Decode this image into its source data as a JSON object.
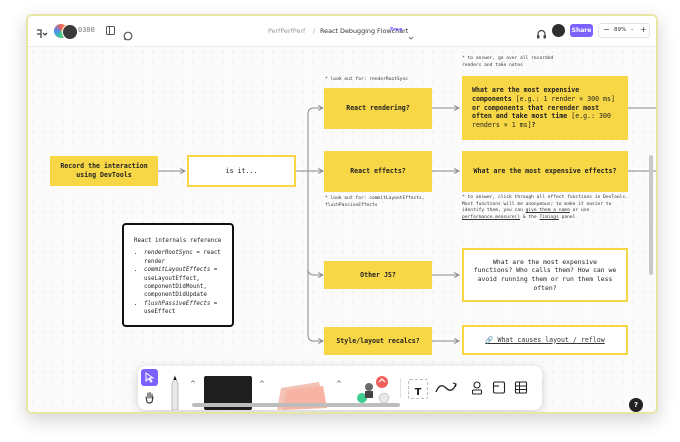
{
  "toolbar": {
    "counter": "0300",
    "breadcrumb_project": "PerfPerfPerf",
    "breadcrumb_sep": "/",
    "file_title": "React Debugging Flowchart",
    "badge": "Free",
    "share_label": "Share",
    "zoom": "89%",
    "zoom_minus": "−",
    "zoom_plus": "+"
  },
  "flow": {
    "start": "Record the interaction\nusing DevTools",
    "isit": "is it...",
    "branch_render": "React rendering?",
    "branch_effects": "React effects?",
    "branch_otherjs": "Other JS?",
    "branch_style": "Style/layout recalcs?",
    "result_render_a": "What are the most expensive components",
    "result_render_b": "[e.g.: 1 render × 300 ms]",
    "result_render_c": " or components that rerender most often and take most time ",
    "result_render_d": "[e.g.: 300 renders × 1 ms]",
    "result_render_e": "?",
    "result_effects": "What are the most expensive effects?",
    "result_otherjs": "What are the most expensive functions? Who calls them? How can we avoid running them or run them less often?",
    "result_style": "🔗 What causes layout / reflow"
  },
  "notes": {
    "top_right": "* to answer, go over all recorded\nrenders and take notes",
    "render_lookout": "* look out for: renderRootSync",
    "effects_lookout": "* look out for: commitLayoutEffects,\nflushPassiveEffects",
    "effects_answer_1": "* to answer, click through all effect functions in DevTools.",
    "effects_answer_2": "Most functions will be anonymous; to make it easier to",
    "effects_answer_3a": "identify them, you can ",
    "effects_answer_3b": "give them a name",
    "effects_answer_3c": " or use",
    "effects_answer_4a": "performance.measure()",
    "effects_answer_4b": " & the ",
    "effects_answer_4c": "Timings",
    "effects_answer_4d": " panel"
  },
  "reference": {
    "title": "React internals reference",
    "items": [
      {
        "fn": "renderRootSync",
        "rest": " = react render"
      },
      {
        "fn": "commitLayoutEffects",
        "rest": " = useLayoutEffect, componentDidMount, componentDidUpdate"
      },
      {
        "fn": "flushPassiveEffects",
        "rest": " = useEffect"
      }
    ]
  },
  "dock": {
    "tools": [
      "pointer-tool",
      "hand-tool",
      "marker-tool",
      "shape-tool",
      "sticky-tool",
      "stamp-tool",
      "text-tool",
      "connector-tool",
      "person-tool",
      "section-tool",
      "table-tool"
    ],
    "text_tool_label": "T"
  },
  "help_label": "?",
  "colors": {
    "accent": "#7b61ff",
    "node_yellow": "#f7d746",
    "arrow": "#8a8a8a"
  }
}
